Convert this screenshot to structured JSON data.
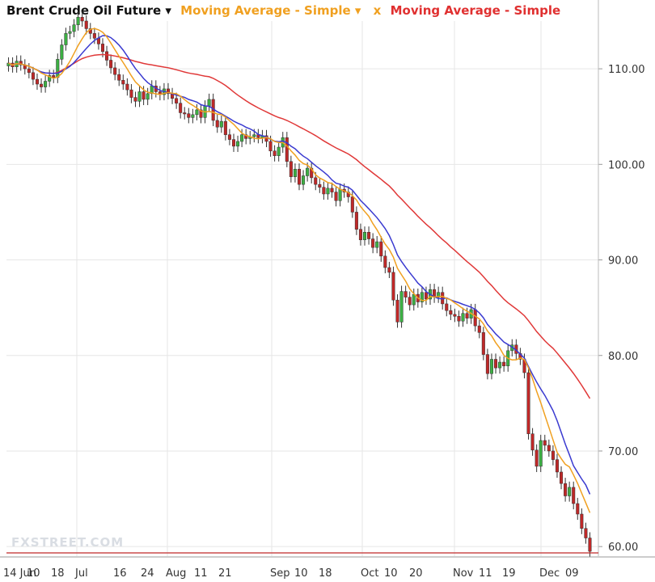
{
  "legend": {
    "main": "Brent Crude Oil Future ▾",
    "ma1": "Moving Average - Simple ▾",
    "close": "x",
    "ma2": "Moving Average - Simple"
  },
  "watermark": "FXSTREET.COM",
  "colors": {
    "up": "#3cb043",
    "down": "#c02828",
    "ma_fast": "#3a3ad0",
    "ma_mid": "#f0a020",
    "ma_slow": "#e03838",
    "grid": "#e6e6e6"
  },
  "chart_data": {
    "type": "candlestick",
    "title": "Brent Crude Oil Future",
    "ylim": [
      59,
      115
    ],
    "ytick_labels": [
      "110.00",
      "100.00",
      "90.00",
      "80.00",
      "70.00",
      "60.00"
    ],
    "xtick_labels": [
      "14 Jun",
      "10",
      "18",
      "Jul",
      "16",
      "24",
      "Aug",
      "11",
      "21",
      "Sep",
      "10",
      "18",
      "Oct",
      "10",
      "20",
      "Nov",
      "11",
      "19",
      "Dec",
      "09"
    ],
    "grid": true,
    "legend_position": "top-left",
    "closes": [
      110.6,
      110.2,
      110.8,
      110.4,
      110.0,
      109.6,
      108.9,
      108.4,
      108.1,
      108.7,
      109.3,
      109.1,
      111.0,
      112.5,
      113.7,
      113.9,
      114.6,
      115.4,
      115.0,
      114.2,
      113.7,
      113.2,
      112.6,
      111.8,
      110.9,
      110.1,
      109.4,
      108.8,
      108.4,
      107.8,
      107.0,
      106.6,
      107.6,
      106.8,
      107.4,
      108.2,
      107.6,
      107.3,
      107.9,
      107.4,
      106.9,
      106.4,
      105.4,
      105.3,
      104.9,
      105.2,
      105.7,
      104.9,
      106.1,
      106.8,
      104.6,
      103.9,
      104.5,
      103.1,
      102.6,
      101.9,
      102.4,
      103.1,
      102.7,
      102.9,
      103.1,
      102.8,
      103.0,
      102.4,
      101.4,
      100.9,
      101.8,
      102.8,
      100.3,
      98.7,
      99.5,
      97.9,
      98.8,
      99.6,
      98.6,
      97.9,
      97.6,
      96.9,
      97.5,
      97.1,
      96.2,
      97.4,
      97.1,
      96.6,
      95.0,
      93.2,
      92.1,
      92.9,
      92.2,
      91.3,
      91.9,
      90.4,
      89.2,
      88.7,
      85.8,
      83.5,
      86.7,
      86.1,
      85.3,
      86.4,
      85.6,
      86.6,
      85.9,
      86.9,
      86.1,
      86.6,
      85.4,
      84.7,
      84.3,
      84.1,
      83.6,
      84.4,
      83.9,
      84.8,
      83.1,
      82.4,
      80.1,
      78.1,
      79.6,
      78.7,
      79.3,
      78.9,
      80.5,
      81.1,
      80.2,
      79.6,
      78.2,
      71.8,
      70.1,
      68.4,
      71.1,
      70.6,
      70.0,
      69.1,
      67.8,
      66.6,
      65.3,
      66.2,
      64.5,
      63.4,
      61.9,
      60.9,
      59.5
    ]
  }
}
